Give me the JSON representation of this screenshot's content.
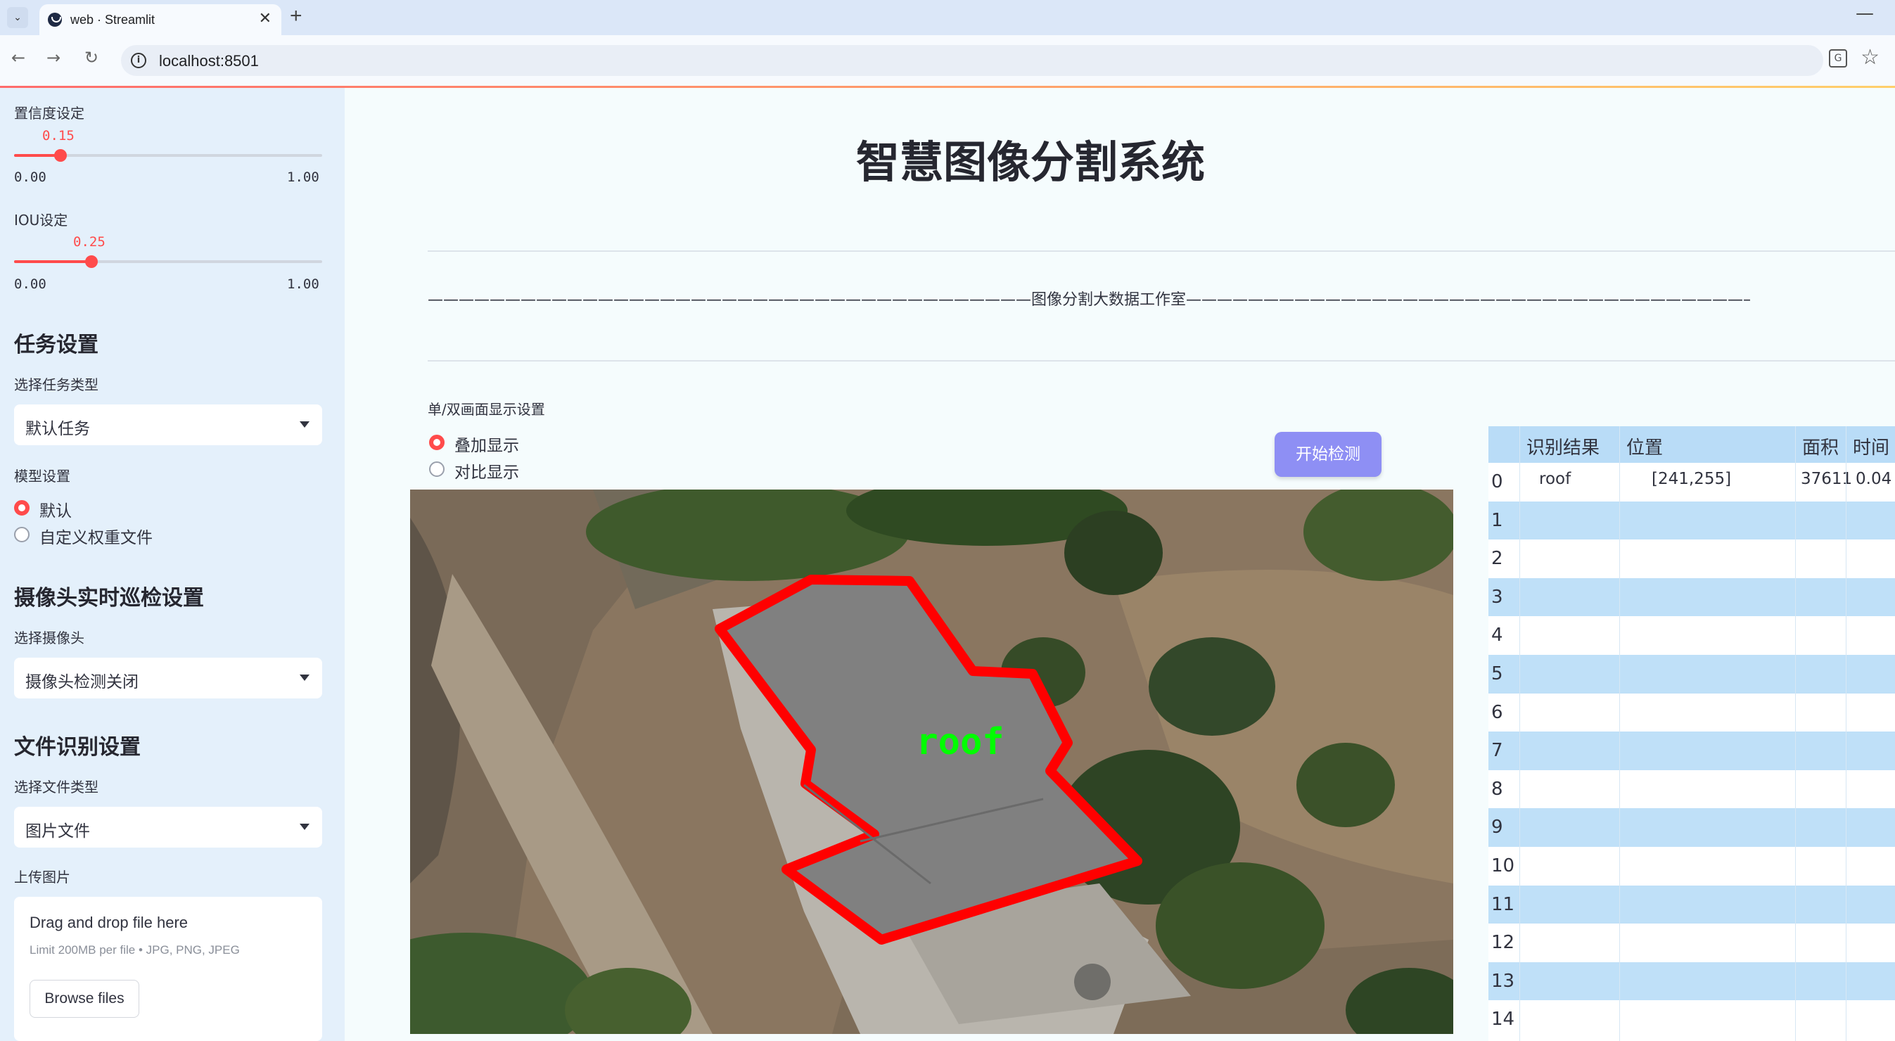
{
  "browser": {
    "tab_title": "web · Streamlit",
    "url": "localhost:8501"
  },
  "sidebar": {
    "confidence": {
      "label": "置信度设定",
      "value": "0.15",
      "min": "0.00",
      "max": "1.00",
      "fraction": 0.15
    },
    "iou": {
      "label": "IOU设定",
      "value": "0.25",
      "min": "0.00",
      "max": "1.00",
      "fraction": 0.25
    },
    "task_section": "任务设置",
    "task_type_label": "选择任务类型",
    "task_type_value": "默认任务",
    "model_label": "模型设置",
    "model_options": [
      "默认",
      "自定义权重文件"
    ],
    "camera_section": "摄像头实时巡检设置",
    "camera_label": "选择摄像头",
    "camera_value": "摄像头检测关闭",
    "file_section": "文件识别设置",
    "file_type_label": "选择文件类型",
    "file_type_value": "图片文件",
    "upload_label": "上传图片",
    "uploader": {
      "title": "Drag and drop file here",
      "limit": "Limit 200MB per file • JPG, PNG, JPEG",
      "button": "Browse files"
    }
  },
  "main": {
    "title": "智慧图像分割系统",
    "banner": "———————————————————————————————————————图像分割大数据工作室———————————————————————————————————————",
    "display_label": "单/双画面显示设置",
    "display_options": [
      "叠加显示",
      "对比显示"
    ],
    "detect_button": "开始检测",
    "detection_label": "roof"
  },
  "table": {
    "headers": [
      "识别结果",
      "位置",
      "面积",
      "时间"
    ],
    "rows": [
      {
        "idx": "0",
        "result": "roof",
        "position": "[241,255]",
        "area": "37611",
        "time": "0.04"
      },
      {
        "idx": "1",
        "result": "",
        "position": "",
        "area": "",
        "time": ""
      },
      {
        "idx": "2",
        "result": "",
        "position": "",
        "area": "",
        "time": ""
      },
      {
        "idx": "3",
        "result": "",
        "position": "",
        "area": "",
        "time": ""
      },
      {
        "idx": "4",
        "result": "",
        "position": "",
        "area": "",
        "time": ""
      },
      {
        "idx": "5",
        "result": "",
        "position": "",
        "area": "",
        "time": ""
      },
      {
        "idx": "6",
        "result": "",
        "position": "",
        "area": "",
        "time": ""
      },
      {
        "idx": "7",
        "result": "",
        "position": "",
        "area": "",
        "time": ""
      },
      {
        "idx": "8",
        "result": "",
        "position": "",
        "area": "",
        "time": ""
      },
      {
        "idx": "9",
        "result": "",
        "position": "",
        "area": "",
        "time": ""
      },
      {
        "idx": "10",
        "result": "",
        "position": "",
        "area": "",
        "time": ""
      },
      {
        "idx": "11",
        "result": "",
        "position": "",
        "area": "",
        "time": ""
      },
      {
        "idx": "12",
        "result": "",
        "position": "",
        "area": "",
        "time": ""
      },
      {
        "idx": "13",
        "result": "",
        "position": "",
        "area": "",
        "time": ""
      },
      {
        "idx": "14",
        "result": "",
        "position": "",
        "area": "",
        "time": ""
      }
    ]
  },
  "colors": {
    "accent": "#ff4b4b",
    "button": "#8e8ff4",
    "sidebar_bg": "#e4f0fb",
    "table_header": "#b9dcf7",
    "mask_outline": "#ff0000",
    "label_text": "#00ff00"
  }
}
